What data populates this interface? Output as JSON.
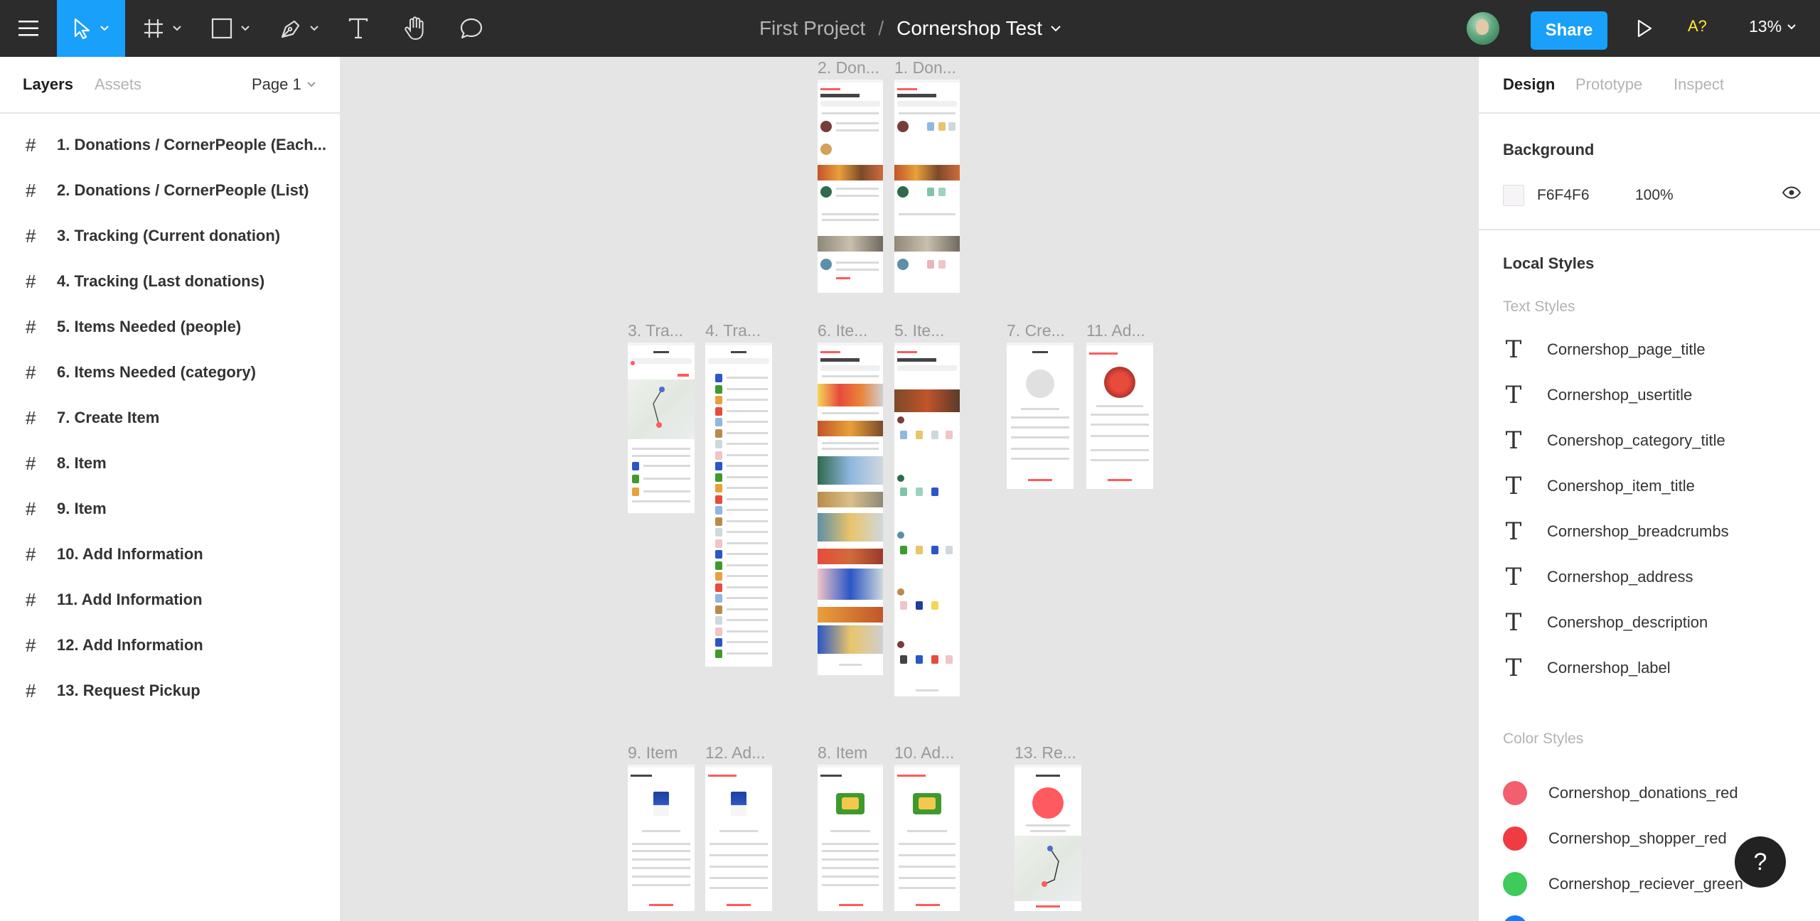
{
  "toolbar": {
    "tools": [
      "menu-icon",
      "move-icon",
      "frame-icon",
      "rectangle-icon",
      "pen-icon",
      "text-icon",
      "hand-icon",
      "comment-icon"
    ],
    "text_tool_glyph": "T"
  },
  "file": {
    "project": "First Project",
    "separator": "/",
    "name": "Cornershop Test"
  },
  "header_right": {
    "share_label": "Share",
    "a_label": "A?",
    "zoom": "13%"
  },
  "left_panel": {
    "tabs": [
      "Layers",
      "Assets"
    ],
    "page": "Page 1",
    "hash": "#",
    "layers": [
      "1. Donations / CornerPeople (Each...",
      "2. Donations / CornerPeople (List)",
      "3. Tracking (Current donation)",
      "4. Tracking (Last donations)",
      "5. Items Needed (people)",
      "6. Items Needed (category)",
      "7. Create Item",
      "8. Item",
      "9. Item",
      "10. Add Information",
      "11. Add Information",
      "12. Add Information",
      "13. Request Pickup"
    ]
  },
  "canvas": {
    "frames": [
      "2. Don...",
      "1. Don...",
      "3. Tra...",
      "4. Tra...",
      "6. Ite...",
      "5. Ite...",
      "7. Cre...",
      "11. Ad...",
      "9. Item",
      "12. Ad...",
      "8. Item",
      "10. Ad...",
      "13. Re..."
    ]
  },
  "right_panel": {
    "tabs": [
      "Design",
      "Prototype",
      "Inspect"
    ],
    "background": {
      "title": "Background",
      "hex": "F6F4F6",
      "opacity": "100%",
      "color": "#f6f4f6"
    },
    "local_styles_title": "Local Styles",
    "text_styles_title": "Text Styles",
    "text_style_glyph": "T",
    "text_styles": [
      "Cornershop_page_title",
      "Cornershop_usertitle",
      "Conershop_category_title",
      "Conershop_item_title",
      "Cornershop_breadcrumbs",
      "Cornershop_address",
      "Conershop_description",
      "Cornershop_label"
    ],
    "color_styles_title": "Color Styles",
    "color_styles": [
      {
        "name": "Cornershop_donations_red",
        "color": "#f25f6e"
      },
      {
        "name": "Cornershop_shopper_red",
        "color": "#f03b43"
      },
      {
        "name": "Cornershop_reciever_green",
        "color": "#3fca5c"
      }
    ]
  },
  "help_label": "?"
}
